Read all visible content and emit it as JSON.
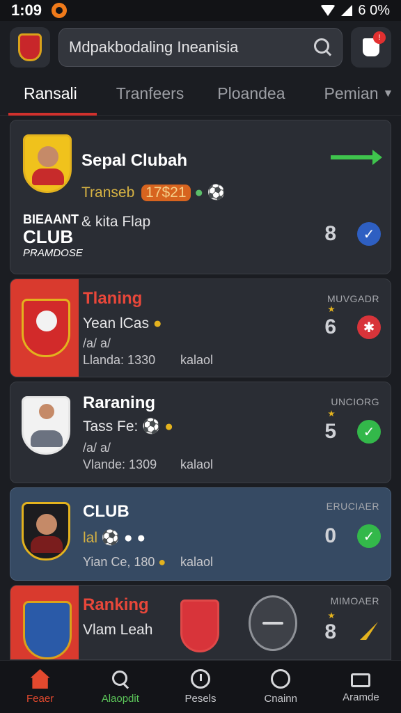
{
  "status_bar": {
    "time": "1:09",
    "battery": "6 0%"
  },
  "header": {
    "search_text": "Mdpakbodaling Ineanisia"
  },
  "tabs": [
    {
      "label": "Ransali",
      "active": true
    },
    {
      "label": "Tranfeers",
      "active": false
    },
    {
      "label": "Ploandea",
      "active": false
    },
    {
      "label": "Pemian",
      "active": false
    }
  ],
  "cards": [
    {
      "title": "Sepal Clubah",
      "line1_prefix": "Transeb",
      "line1_badge": "17$21",
      "line2": "& kita Flap",
      "club_top": "BIEAANT",
      "club_mid": "CLUB",
      "club_bottom": "PRAMDOSE",
      "rank": "8"
    },
    {
      "title": "Tlaning",
      "label": "MUVGADR",
      "line1": "Yean lCas",
      "line2": "/a/ a/",
      "line3": "Llanda: 1330",
      "line3_right": "kalaol",
      "rank": "6"
    },
    {
      "title": "Raraning",
      "label": "UNCIORG",
      "line1": "Tass Fe:",
      "line2": "/a/ a/",
      "line3": "Vlande: 1309",
      "line3_right": "kalaol",
      "rank": "5"
    },
    {
      "title": "CLUB",
      "label": "ERUCIAER",
      "line1": "lal",
      "line3": "Yian Ce, 180",
      "line3_right": "kalaol",
      "rank": "0"
    },
    {
      "title": "Ranking",
      "label": "MIMOAER",
      "line1": "Vlam Leah",
      "rank": "8"
    }
  ],
  "bottom_nav": [
    {
      "label": "Feaer",
      "icon": "home-icon"
    },
    {
      "label": "Alaopdit",
      "icon": "search-icon"
    },
    {
      "label": "Pesels",
      "icon": "clock-icon"
    },
    {
      "label": "Cnainn",
      "icon": "chat-icon"
    },
    {
      "label": "Aramde",
      "icon": "screen-icon"
    }
  ],
  "colors": {
    "accent": "#d0312d",
    "background": "#1b1d22",
    "card": "#2a2d34",
    "success": "#33b84a"
  }
}
